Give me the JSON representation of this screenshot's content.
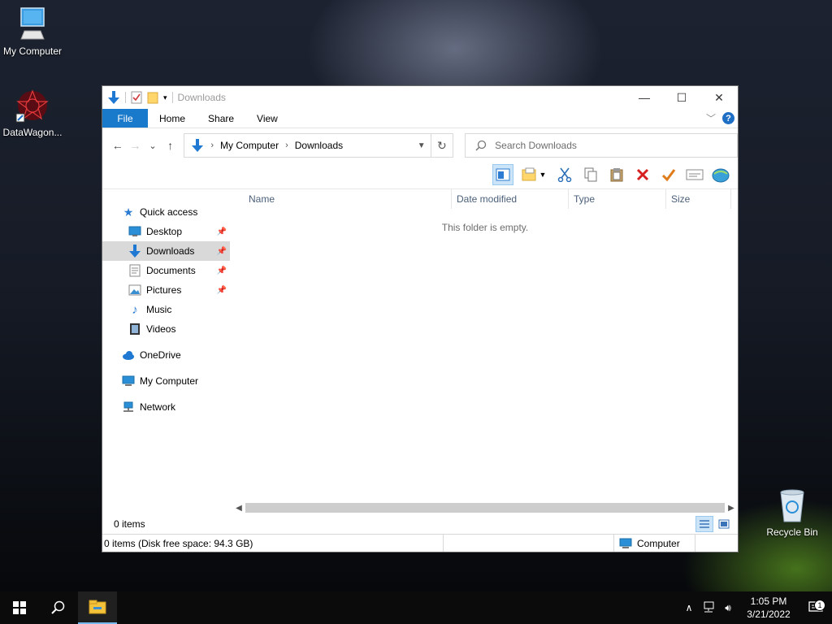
{
  "desktop": {
    "icons": [
      {
        "label": "My Computer",
        "icon": "computer-icon"
      },
      {
        "label": "DataWagon...",
        "icon": "datawagon-icon"
      },
      {
        "label": "Recycle Bin",
        "icon": "recycle-bin-icon"
      }
    ]
  },
  "window": {
    "title": "Downloads",
    "controls": {
      "minimize": "—",
      "maximize": "☐",
      "close": "✕"
    }
  },
  "ribbon": {
    "tabs": [
      "File",
      "Home",
      "Share",
      "View"
    ],
    "expand": "﹀",
    "help": "?"
  },
  "navigation": {
    "back": "←",
    "forward": "→",
    "recent": "⌄",
    "up": "↑",
    "breadcrumb": [
      "My Computer",
      "Downloads"
    ],
    "refresh": "↻",
    "search_placeholder": "Search Downloads"
  },
  "nav_pane": {
    "quick_access": "Quick access",
    "quick_items": [
      {
        "label": "Desktop",
        "pinned": true
      },
      {
        "label": "Downloads",
        "pinned": true
      },
      {
        "label": "Documents",
        "pinned": true
      },
      {
        "label": "Pictures",
        "pinned": true
      },
      {
        "label": "Music",
        "pinned": false
      },
      {
        "label": "Videos",
        "pinned": false
      }
    ],
    "onedrive": "OneDrive",
    "my_computer": "My Computer",
    "network": "Network"
  },
  "content": {
    "columns": [
      "Name",
      "Date modified",
      "Type",
      "Size"
    ],
    "empty_message": "This folder is empty.",
    "item_count": "0 items"
  },
  "status": {
    "left": "0 items (Disk free space: 94.3 GB)",
    "location": "Computer"
  },
  "taskbar": {
    "time": "1:05 PM",
    "date": "3/21/2022",
    "notification_count": "1"
  },
  "colors": {
    "accent": "#1979ca",
    "selected_nav": "#d9d9d9",
    "header_text": "#4c607a"
  }
}
